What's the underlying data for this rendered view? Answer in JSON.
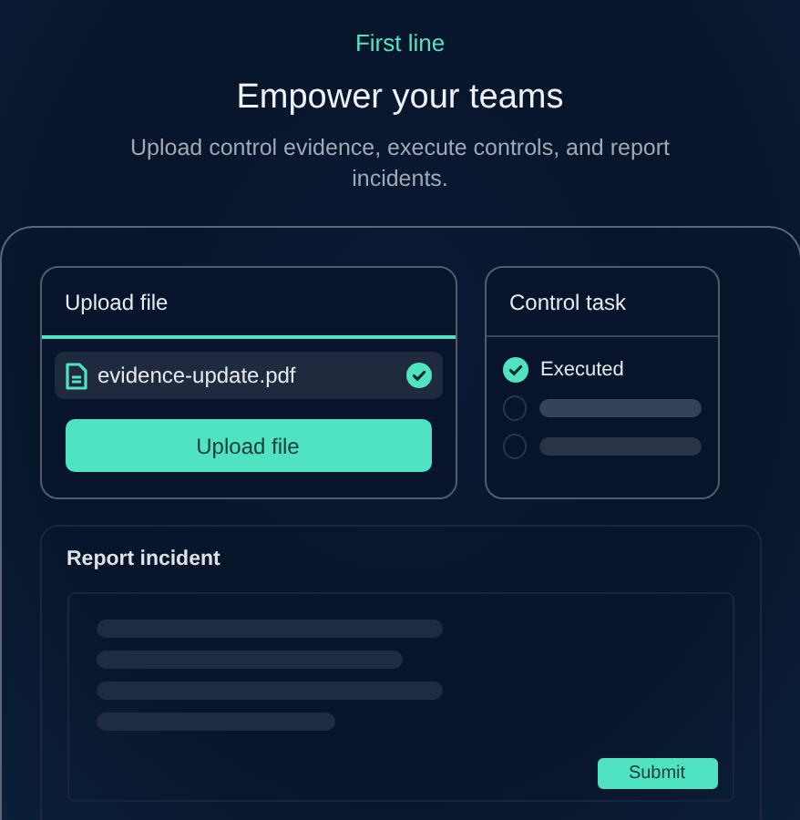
{
  "eyebrow": "First line",
  "title": "Empower your teams",
  "subtitle": "Upload control evidence, execute controls, and report incidents.",
  "upload": {
    "title": "Upload file",
    "file": {
      "name": "evidence-update.pdf",
      "uploaded": true
    },
    "button": "Upload file"
  },
  "control_task": {
    "title": "Control task",
    "tasks": [
      {
        "label": "Executed",
        "checked": true
      },
      {
        "checked": false
      },
      {
        "checked": false
      }
    ]
  },
  "report": {
    "title": "Report incident",
    "button": "Submit"
  }
}
